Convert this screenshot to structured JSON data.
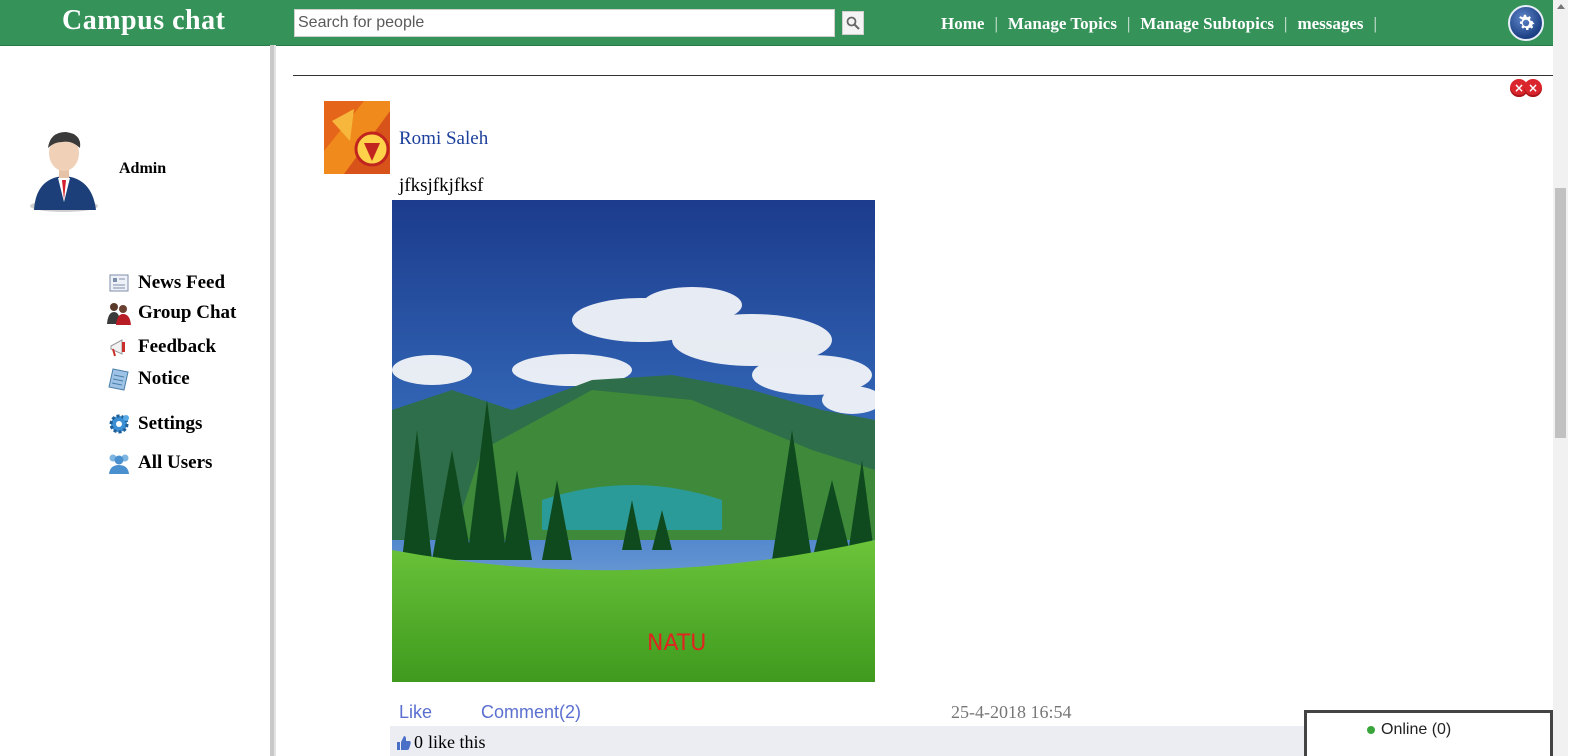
{
  "header": {
    "brand": "Campus chat",
    "search": {
      "placeholder": "Search for people",
      "value": ""
    },
    "nav": [
      {
        "label": "Home"
      },
      {
        "label": "Manage Topics"
      },
      {
        "label": "Manage Subtopics"
      },
      {
        "label": "messages"
      }
    ],
    "settings_icon": "gear-icon",
    "accent": "#35935a"
  },
  "sidebar": {
    "user_name": "Admin",
    "items": [
      {
        "label": "News Feed",
        "icon": "newsfeed-icon"
      },
      {
        "label": "Group Chat",
        "icon": "group-chat-icon"
      },
      {
        "label": "Feedback",
        "icon": "feedback-icon"
      },
      {
        "label": "Notice",
        "icon": "notice-icon"
      },
      {
        "label": "Settings",
        "icon": "settings-icon"
      },
      {
        "label": "All Users",
        "icon": "users-icon"
      }
    ]
  },
  "post": {
    "author": "Romi Saleh",
    "text": "jfksjfkjfksf",
    "image_watermark": "NATU",
    "actions": {
      "like": "Like",
      "comment": "Comment(2)"
    },
    "timestamp": "25-4-2018 16:54",
    "likes": {
      "count": "0",
      "suffix": "like this"
    }
  },
  "chat_panel": {
    "label": "Online (0)"
  }
}
